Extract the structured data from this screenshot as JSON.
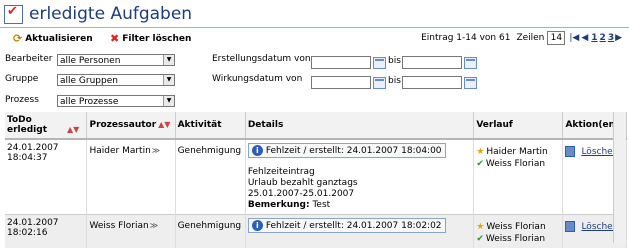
{
  "page": {
    "title": "erledigte Aufgaben"
  },
  "toolbar": {
    "refresh_label": "Aktualisieren",
    "clear_filter_label": "Filter löschen",
    "pager": {
      "range_text": "Eintrag 1-14 von 61",
      "rows_label": "Zeilen",
      "rows_value": "14",
      "pages": [
        "1",
        "2",
        "3"
      ]
    }
  },
  "filters": {
    "bearbeiter": {
      "label": "Bearbeiter",
      "value": "alle Personen"
    },
    "gruppe": {
      "label": "Gruppe",
      "value": "alle Gruppen"
    },
    "prozess": {
      "label": "Prozess",
      "value": "alle Prozesse"
    },
    "erstellungsdatum": {
      "label": "Erstellungsdatum von",
      "bis": "bis"
    },
    "wirkungsdatum": {
      "label": "Wirkungsdatum von",
      "bis": "bis"
    }
  },
  "table": {
    "headers": {
      "todo": "ToDo erledigt",
      "autor": "Prozessautor",
      "aktivitaet": "Aktivität",
      "details": "Details",
      "verlauf": "Verlauf",
      "aktion": "Aktion(en)"
    },
    "rows": [
      {
        "date": "24.01.2007",
        "time": "18:04:37",
        "autor": "Haider Martin",
        "aktivitaet": "Genehmigung",
        "detail_title": "Fehlzeit / erstellt: 24.01.2007 18:04:00",
        "detail_lines": [
          "Fehlzeiteintrag",
          "Urlaub bezahlt ganztags",
          "25.01.2007-25.01.2007"
        ],
        "bemerkung_label": "Bemerkung:",
        "bemerkung": "Test",
        "verlauf": [
          "Haider Martin",
          "Weiss Florian"
        ],
        "action": "Löschen"
      },
      {
        "date": "24.01.2007",
        "time": "18:02:16",
        "autor": "Weiss Florian",
        "aktivitaet": "Genehmigung",
        "detail_title": "Fehlzeit / erstellt: 24.01.2007 18:02:02",
        "verlauf": [
          "Weiss Florian",
          "Weiss Florian"
        ],
        "action": "Löschen"
      }
    ]
  }
}
